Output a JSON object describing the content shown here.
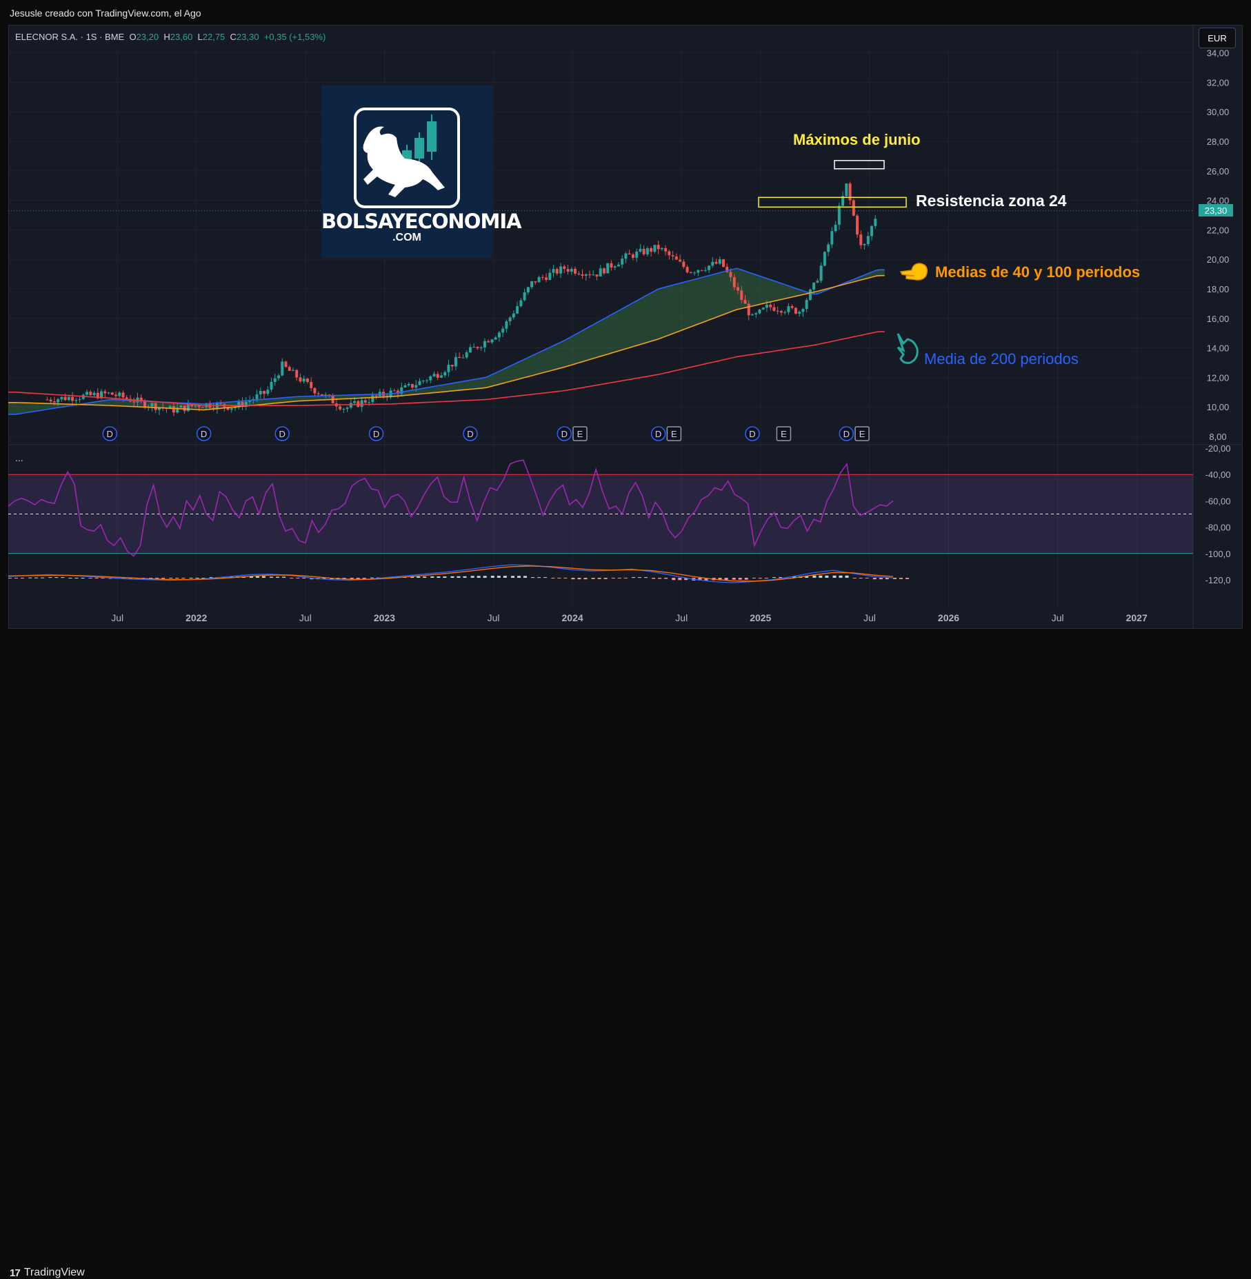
{
  "header": {
    "creator_text": "Jesusle creado con TradingView.com, el Ago"
  },
  "legend": {
    "symbol": "ELECNOR S.A. · 1S · BME",
    "o_label": "O",
    "o_value": "23,20",
    "h_label": "H",
    "h_value": "23,60",
    "l_label": "L",
    "l_value": "22,75",
    "c_label": "C",
    "c_value": "23,30",
    "change": "+0,35 (+1,53%)"
  },
  "currency": "EUR",
  "last_price": "23,30",
  "indicator_menu": "...",
  "footer": {
    "brand": "TradingView",
    "brand_mark": "17"
  },
  "logo": {
    "line1": "BOLSAYECONOMIA",
    "line2": ".COM"
  },
  "annotations": {
    "maximos": "Máximos de junio",
    "resistencia": "Resistencia zona 24",
    "medias": "Medias de 40 y 100 periodos",
    "media200": "Media de 200 periodos"
  },
  "colors": {
    "up": "#26a69a",
    "down": "#ef5350",
    "ma40": "#2962ff",
    "ma100": "#f7a21b",
    "ma200": "#f23645",
    "rsi": "#9c27b0",
    "bg": "#161a25",
    "annotation_yellow": "#ffeb3b",
    "annotation_orange": "#ff9800",
    "annotation_blue": "#2962ff"
  },
  "chart_data": {
    "type": "candlestick",
    "timeframe": "1S",
    "x_tick_labels": [
      "Jul",
      "2022",
      "Jul",
      "2023",
      "Jul",
      "2024",
      "Jul",
      "2025",
      "Jul",
      "2026",
      "Jul",
      "2027"
    ],
    "y_tick_labels": [
      "8,00",
      "10,00",
      "12,00",
      "14,00",
      "16,00",
      "18,00",
      "20,00",
      "22,00",
      "24,00",
      "26,00",
      "28,00",
      "30,00",
      "32,00",
      "34,00"
    ],
    "ylim": [
      8,
      34
    ],
    "close_path": [
      [
        "2021-03",
        10.5
      ],
      [
        "2021-05",
        10.7
      ],
      [
        "2021-07",
        10.9
      ],
      [
        "2021-09",
        10.3
      ],
      [
        "2021-11",
        9.8
      ],
      [
        "2022-01",
        10.2
      ],
      [
        "2022-03",
        10.0
      ],
      [
        "2022-05",
        11.0
      ],
      [
        "2022-06",
        12.8
      ],
      [
        "2022-08",
        11.2
      ],
      [
        "2022-10",
        9.9
      ],
      [
        "2022-12",
        10.7
      ],
      [
        "2023-02",
        11.3
      ],
      [
        "2023-04",
        12.3
      ],
      [
        "2023-06",
        13.8
      ],
      [
        "2023-08",
        15.2
      ],
      [
        "2023-10",
        18.5
      ],
      [
        "2023-12",
        19.4
      ],
      [
        "2024-02",
        19.0
      ],
      [
        "2024-04",
        20.2
      ],
      [
        "2024-06",
        20.8
      ],
      [
        "2024-08",
        19.2
      ],
      [
        "2024-10",
        19.8
      ],
      [
        "2024-12",
        16.0
      ],
      [
        "2025-01",
        16.8
      ],
      [
        "2025-03",
        16.5
      ],
      [
        "2025-04",
        18.3
      ],
      [
        "2025-05",
        21.5
      ],
      [
        "2025-06",
        25.0
      ],
      [
        "2025-07",
        20.5
      ],
      [
        "2025-08",
        23.3
      ]
    ],
    "candle_volatility": 0.35,
    "series": [
      {
        "name": "MA40",
        "color": "#2962ff",
        "values": [
          [
            "2021-01",
            9.5
          ],
          [
            "2021-07",
            10.5
          ],
          [
            "2022-01",
            10.2
          ],
          [
            "2022-07",
            10.7
          ],
          [
            "2023-01",
            10.9
          ],
          [
            "2023-07",
            12.0
          ],
          [
            "2023-12",
            14.5
          ],
          [
            "2024-06",
            18.0
          ],
          [
            "2024-11",
            19.4
          ],
          [
            "2025-04",
            17.6
          ],
          [
            "2025-08",
            19.3
          ]
        ]
      },
      {
        "name": "MA100",
        "color": "#f7a21b",
        "values": [
          [
            "2021-01",
            10.3
          ],
          [
            "2021-07",
            10.1
          ],
          [
            "2022-01",
            9.8
          ],
          [
            "2022-07",
            10.4
          ],
          [
            "2023-01",
            10.7
          ],
          [
            "2023-07",
            11.3
          ],
          [
            "2023-12",
            12.7
          ],
          [
            "2024-06",
            14.6
          ],
          [
            "2024-11",
            16.6
          ],
          [
            "2025-04",
            17.8
          ],
          [
            "2025-08",
            18.9
          ]
        ]
      },
      {
        "name": "MA200",
        "color": "#f23645",
        "values": [
          [
            "2021-01",
            11.0
          ],
          [
            "2021-07",
            10.6
          ],
          [
            "2022-01",
            10.1
          ],
          [
            "2022-07",
            10.1
          ],
          [
            "2023-01",
            10.2
          ],
          [
            "2023-07",
            10.5
          ],
          [
            "2023-12",
            11.1
          ],
          [
            "2024-06",
            12.2
          ],
          [
            "2024-11",
            13.4
          ],
          [
            "2025-04",
            14.2
          ],
          [
            "2025-08",
            15.1
          ]
        ]
      }
    ],
    "markers": [
      {
        "date": "2021-07",
        "label": "D"
      },
      {
        "date": "2022-01",
        "label": "D"
      },
      {
        "date": "2022-06",
        "label": "D"
      },
      {
        "date": "2022-12",
        "label": "D"
      },
      {
        "date": "2023-06",
        "label": "D"
      },
      {
        "date": "2023-12",
        "label": "D"
      },
      {
        "date": "2024-01",
        "label": "E"
      },
      {
        "date": "2024-06",
        "label": "D"
      },
      {
        "date": "2024-07",
        "label": "E"
      },
      {
        "date": "2024-12",
        "label": "D"
      },
      {
        "date": "2025-02",
        "label": "E"
      },
      {
        "date": "2025-06",
        "label": "D"
      },
      {
        "date": "2025-07",
        "label": "E"
      }
    ],
    "oscillator": {
      "y_tick_labels": [
        "-20,00",
        "-40,00",
        "-60,00",
        "-80,00",
        "-100,0",
        "-120,0"
      ],
      "upper_band": -40,
      "lower_band": -100,
      "mid": -70,
      "values": [
        -64,
        -60,
        -58,
        -60,
        -63,
        -59,
        -61,
        -62,
        -48,
        -38,
        -47,
        -79,
        -82,
        -83,
        -78,
        -90,
        -94,
        -88,
        -98,
        -102,
        -94,
        -63,
        -48,
        -71,
        -80,
        -72,
        -81,
        -60,
        -67,
        -56,
        -70,
        -75,
        -53,
        -57,
        -67,
        -73,
        -60,
        -57,
        -70,
        -54,
        -47,
        -71,
        -83,
        -81,
        -90,
        -92,
        -75,
        -84,
        -78,
        -67,
        -66,
        -62,
        -49,
        -45,
        -43,
        -51,
        -52,
        -65,
        -57,
        -55,
        -60,
        -72,
        -65,
        -55,
        -47,
        -42,
        -57,
        -61,
        -61,
        -42,
        -61,
        -75,
        -61,
        -50,
        -52,
        -44,
        -32,
        -30,
        -29,
        -42,
        -56,
        -71,
        -60,
        -52,
        -48,
        -63,
        -59,
        -65,
        -54,
        -36,
        -53,
        -66,
        -64,
        -70,
        -54,
        -46,
        -56,
        -73,
        -61,
        -68,
        -82,
        -88,
        -83,
        -73,
        -68,
        -59,
        -56,
        -50,
        -52,
        -45,
        -55,
        -58,
        -62,
        -94,
        -83,
        -74,
        -69,
        -80,
        -81,
        -75,
        -71,
        -83,
        -74,
        -76,
        -60,
        -51,
        -39,
        -32,
        -64,
        -71,
        -69,
        -66,
        -63,
        -64,
        -60
      ]
    },
    "macd": {
      "macd": [
        0.1,
        0.2,
        0.25,
        0.2,
        0.1,
        0.0,
        -0.1,
        -0.15,
        -0.2,
        -0.15,
        -0.05,
        0.1,
        0.25,
        0.3,
        0.2,
        0.0,
        -0.15,
        -0.2,
        -0.1,
        0.05,
        0.2,
        0.35,
        0.5,
        0.7,
        0.9,
        1.05,
        1.0,
        0.85,
        0.65,
        0.55,
        0.6,
        0.7,
        0.5,
        0.2,
        -0.1,
        -0.3,
        -0.4,
        -0.3,
        -0.15,
        0.1,
        0.4,
        0.6,
        0.35,
        0.1,
        0.0
      ],
      "signal": [
        0.15,
        0.18,
        0.2,
        0.2,
        0.15,
        0.08,
        0.0,
        -0.08,
        -0.14,
        -0.15,
        -0.1,
        0.0,
        0.12,
        0.22,
        0.22,
        0.12,
        -0.02,
        -0.12,
        -0.12,
        -0.03,
        0.1,
        0.24,
        0.38,
        0.55,
        0.74,
        0.9,
        0.95,
        0.9,
        0.77,
        0.65,
        0.62,
        0.65,
        0.58,
        0.38,
        0.12,
        -0.1,
        -0.25,
        -0.28,
        -0.2,
        -0.02,
        0.22,
        0.42,
        0.4,
        0.22,
        0.1
      ]
    }
  }
}
